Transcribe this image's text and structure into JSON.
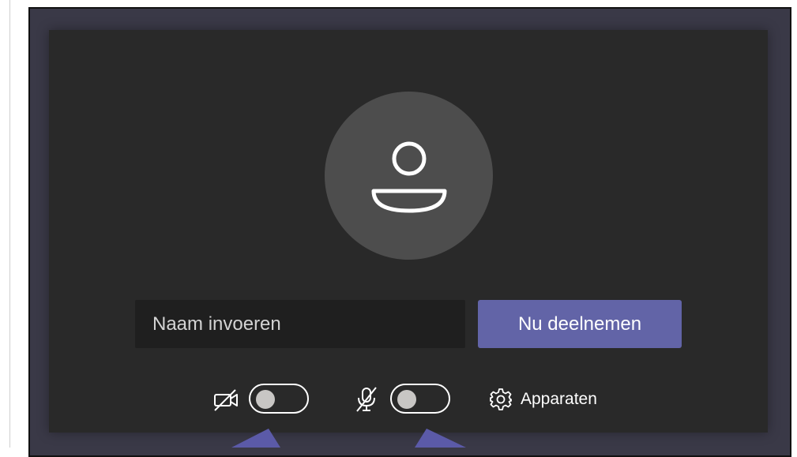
{
  "prejoin": {
    "avatar_icon": "person-icon",
    "name_input": {
      "placeholder": "Naam invoeren",
      "value": ""
    },
    "join_button": {
      "label": "Nu deelnemen"
    },
    "camera": {
      "icon": "camera-off-icon",
      "enabled": false
    },
    "microphone": {
      "icon": "mic-off-icon",
      "enabled": false
    },
    "devices": {
      "icon": "gear-icon",
      "label": "Apparaten"
    }
  },
  "colors": {
    "frame_background": "#3a3947",
    "panel_background": "#292929",
    "avatar_background": "#4d4d4d",
    "input_background": "#1f1f1f",
    "accent": "#6264a7",
    "pointer": "#5b5aa8"
  }
}
